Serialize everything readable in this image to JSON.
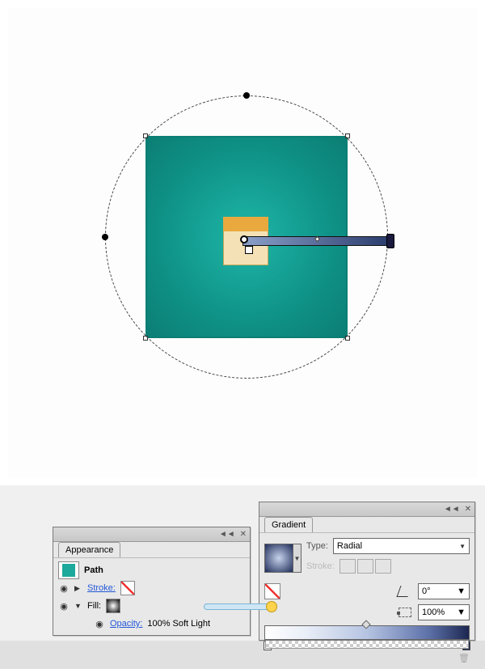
{
  "panels": {
    "appearance": {
      "title": "Appearance",
      "object": "Path",
      "stroke_label": "Stroke:",
      "fill_label": "Fill:",
      "opacity_label": "Opacity:",
      "opacity_value": "100% Soft Light"
    },
    "gradient": {
      "title": "Gradient",
      "type_label": "Type:",
      "type_value": "Radial",
      "stroke_label": "Stroke:",
      "angle_value": "0°",
      "aspect_value": "100%"
    }
  },
  "chart_data": {
    "type": "other",
    "note": "Illustrator canvas with teal rectangle (approx 250x250) filled with radial gradient; gradient annotator circle and handle visible; small notepad icon at center.",
    "gradient_stops": [
      {
        "position": 0,
        "color": "#ffffff"
      },
      {
        "position": 100,
        "color": "#1c2750"
      }
    ]
  }
}
